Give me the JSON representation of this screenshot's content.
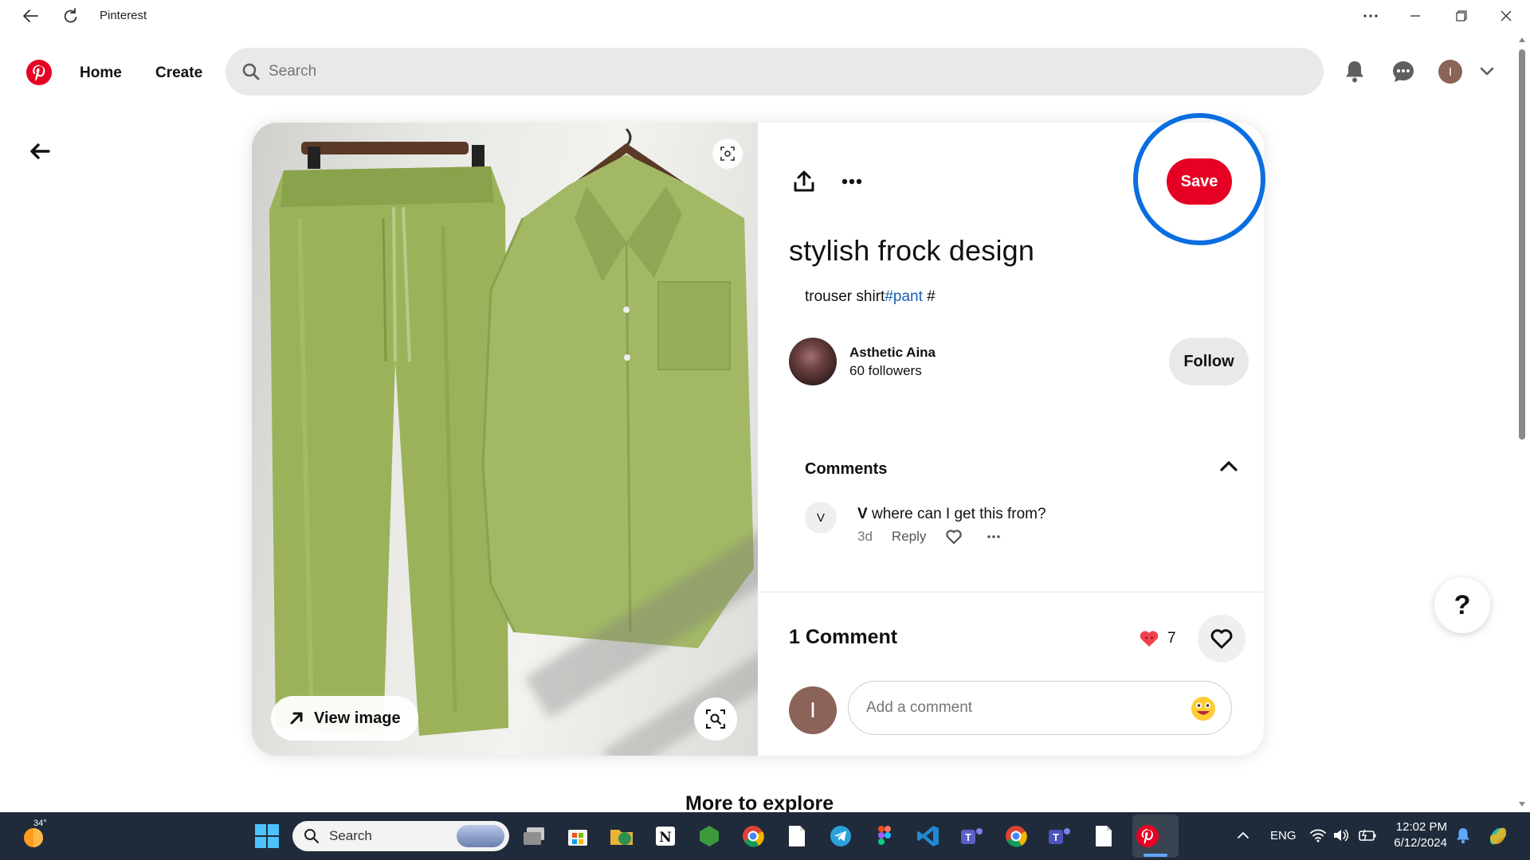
{
  "window": {
    "title": "Pinterest"
  },
  "header": {
    "nav": [
      "Home",
      "Create"
    ],
    "search_placeholder": "Search",
    "user_initial": "I"
  },
  "pin": {
    "title": "stylish frock design",
    "description_text": "trouser shirt",
    "description_tag": "#pant",
    "description_trailing": " #",
    "save_label": "Save",
    "view_image_label": "View image",
    "creator": {
      "name": "Asthetic Aina",
      "followers": "60 followers"
    },
    "follow_label": "Follow",
    "comments": {
      "heading": "Comments",
      "items": [
        {
          "avatar_initial": "V",
          "author": "V",
          "text": "where can I get this from?",
          "age": "3d",
          "reply_label": "Reply"
        }
      ],
      "count_label": "1 Comment",
      "reactions": "7",
      "add_placeholder": "Add a comment"
    }
  },
  "footer_heading": "More to explore",
  "help_label": "?",
  "taskbar": {
    "temperature": "34°",
    "search_placeholder": "Search",
    "language": "ENG",
    "time": "12:02 PM",
    "date": "6/12/2024"
  },
  "colors": {
    "brand": "#e60023",
    "highlight_ring": "#0a6ee0",
    "tag_link": "#1a5fb4"
  }
}
